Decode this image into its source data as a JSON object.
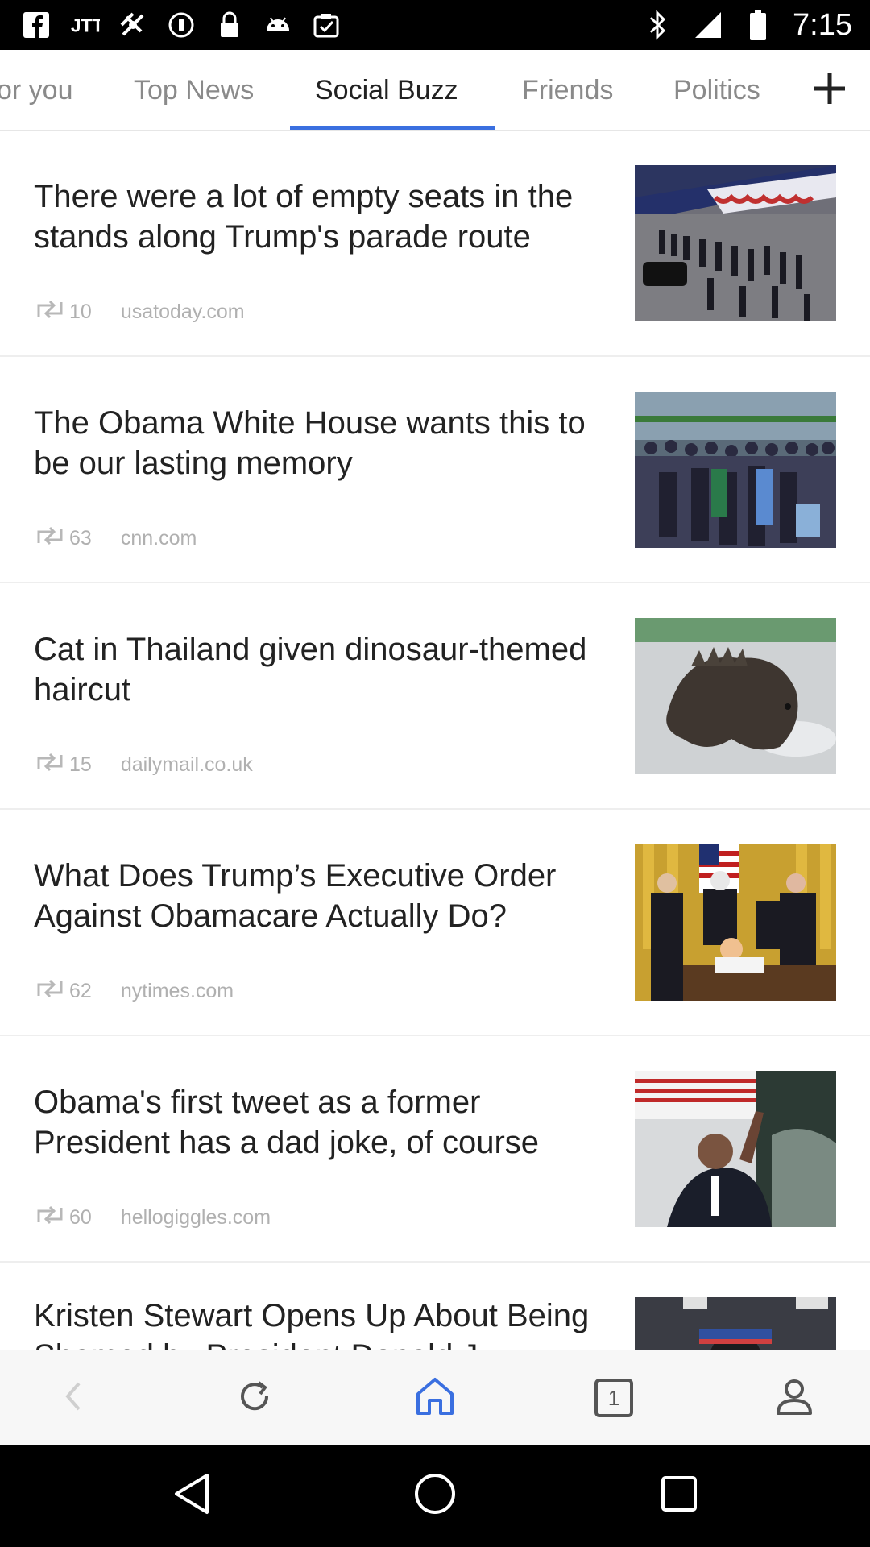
{
  "status_bar": {
    "time": "7:15",
    "left_icons": [
      "facebook-icon",
      "jio-icon",
      "fake-gps-icon",
      "sync-icon",
      "lock-icon",
      "android-icon",
      "clipboard-icon"
    ],
    "right_icons": [
      "bluetooth-icon",
      "signal-icon",
      "battery-icon"
    ]
  },
  "tabs": [
    {
      "label": "or you",
      "active": false
    },
    {
      "label": "Top News",
      "active": false
    },
    {
      "label": "Social Buzz",
      "active": true
    },
    {
      "label": "Friends",
      "active": false
    },
    {
      "label": "Politics",
      "active": false
    }
  ],
  "add_tab_icon": "plus-icon",
  "articles": [
    {
      "title": "There were a lot of empty seats in the stands along Trump's parade route",
      "shares": "10",
      "source": "usatoday.com"
    },
    {
      "title": "The Obama White House wants this to be our lasting memory",
      "shares": "63",
      "source": "cnn.com"
    },
    {
      "title": "Cat in Thailand given dinosaur-themed haircut",
      "shares": "15",
      "source": "dailymail.co.uk"
    },
    {
      "title": "What Does Trump’s Executive Order Against Obamacare Actually Do?",
      "shares": "62",
      "source": "nytimes.com"
    },
    {
      "title": "Obama's first tweet as a former President has a dad joke, of course",
      "shares": "60",
      "source": "hellogiggles.com"
    },
    {
      "title": "Kristen Stewart Opens Up About Being Shamed by President Donald J",
      "shares": "",
      "source": ""
    }
  ],
  "bottom_nav": [
    "back-icon",
    "refresh-icon",
    "home-icon",
    "tabs-icon",
    "profile-icon"
  ],
  "tabs_count": "1",
  "colors": {
    "accent": "#3a6fe0",
    "text": "#222222",
    "muted": "#8a8a8a"
  }
}
